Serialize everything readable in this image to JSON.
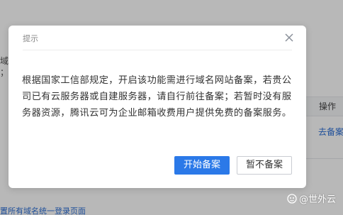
{
  "background": {
    "left_fragment": "域\n；",
    "table_column_header": "操作",
    "row_action": "去备案",
    "bottom_link": "置所有域名统一登录页面"
  },
  "dialog": {
    "title": "提示",
    "message": "根据国家工信部规定，开启该功能需进行域名网站备案，若贵公司已有云服务器或自建服务器，请自行前往备案；若暂时没有服务器资源，腾讯云可为企业邮箱收费用户提供免费的备案服务。",
    "primary_button": "开始备案",
    "secondary_button": "暂不备案"
  },
  "watermark": {
    "text": "@世外云",
    "icon": "watermark-logo-icon"
  },
  "colors": {
    "primary": "#2b79e8",
    "link": "#2d6fd6",
    "mask": "rgba(0,0,0,0.28)"
  }
}
